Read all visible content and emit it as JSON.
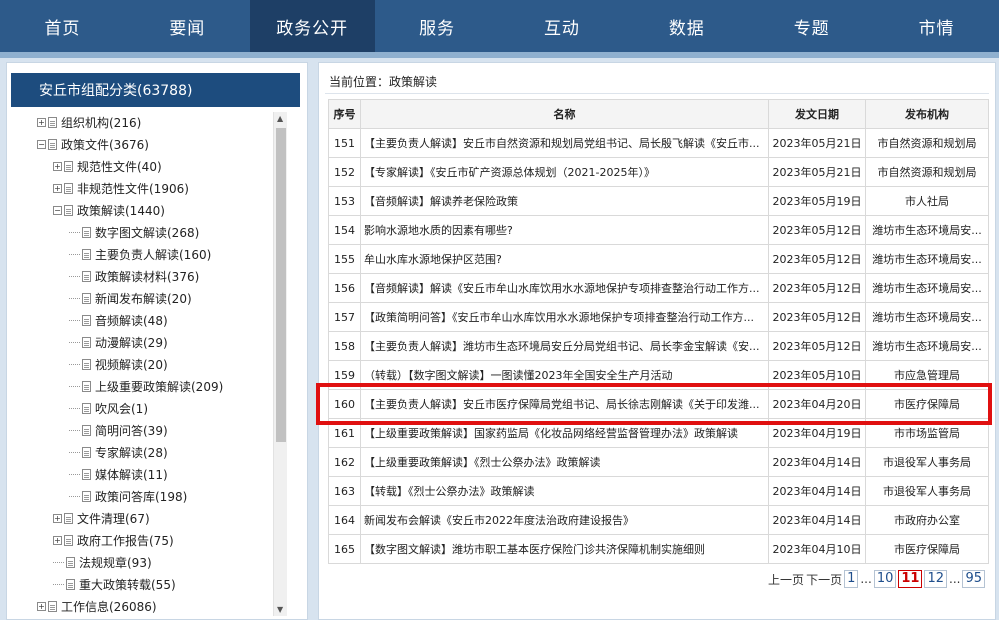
{
  "nav": {
    "items": [
      "首页",
      "要闻",
      "政务公开",
      "服务",
      "互动",
      "数据",
      "专题",
      "市情"
    ],
    "active_index": 2
  },
  "sidebar": {
    "title": "安丘市组配分类(63788)",
    "tree": [
      {
        "level": 0,
        "toggle": "+",
        "label": "组织机构(216)"
      },
      {
        "level": 0,
        "toggle": "−",
        "label": "政策文件(3676)"
      },
      {
        "level": 1,
        "toggle": "+",
        "label": "规范性文件(40)"
      },
      {
        "level": 1,
        "toggle": "+",
        "label": "非规范性文件(1906)"
      },
      {
        "level": 1,
        "toggle": "−",
        "label": "政策解读(1440)"
      },
      {
        "level": 2,
        "toggle": "",
        "label": "数字图文解读(268)"
      },
      {
        "level": 2,
        "toggle": "",
        "label": "主要负责人解读(160)"
      },
      {
        "level": 2,
        "toggle": "",
        "label": "政策解读材料(376)"
      },
      {
        "level": 2,
        "toggle": "",
        "label": "新闻发布解读(20)"
      },
      {
        "level": 2,
        "toggle": "",
        "label": "音频解读(48)"
      },
      {
        "level": 2,
        "toggle": "",
        "label": "动漫解读(29)"
      },
      {
        "level": 2,
        "toggle": "",
        "label": "视频解读(20)"
      },
      {
        "level": 2,
        "toggle": "",
        "label": "上级重要政策解读(209)"
      },
      {
        "level": 2,
        "toggle": "",
        "label": "吹风会(1)"
      },
      {
        "level": 2,
        "toggle": "",
        "label": "简明问答(39)"
      },
      {
        "level": 2,
        "toggle": "",
        "label": "专家解读(28)"
      },
      {
        "level": 2,
        "toggle": "",
        "label": "媒体解读(11)"
      },
      {
        "level": 2,
        "toggle": "",
        "label": "政策问答库(198)"
      },
      {
        "level": 1,
        "toggle": "+",
        "label": "文件清理(67)"
      },
      {
        "level": 1,
        "toggle": "+",
        "label": "政府工作报告(75)"
      },
      {
        "level": 1,
        "toggle": "",
        "label": "法规规章(93)"
      },
      {
        "level": 1,
        "toggle": "",
        "label": "重大政策转载(55)"
      },
      {
        "level": 0,
        "toggle": "+",
        "label": "工作信息(26086)"
      }
    ]
  },
  "main": {
    "breadcrumb": "当前位置：政策解读",
    "columns": [
      "序号",
      "名称",
      "发文日期",
      "发布机构"
    ],
    "rows": [
      {
        "no": "151",
        "title": "【主要负责人解读】安丘市自然资源和规划局党组书记、局长殷飞解读《安丘市...",
        "date": "2023年05月21日",
        "org": "市自然资源和规划局"
      },
      {
        "no": "152",
        "title": "【专家解读】《安丘市矿产资源总体规划（2021-2025年）》",
        "date": "2023年05月21日",
        "org": "市自然资源和规划局"
      },
      {
        "no": "153",
        "title": "【音频解读】解读养老保险政策",
        "date": "2023年05月19日",
        "org": "市人社局"
      },
      {
        "no": "154",
        "title": "影响水源地水质的因素有哪些?",
        "date": "2023年05月12日",
        "org": "潍坊市生态环境局安..."
      },
      {
        "no": "155",
        "title": "牟山水库水源地保护区范围?",
        "date": "2023年05月12日",
        "org": "潍坊市生态环境局安..."
      },
      {
        "no": "156",
        "title": "【音频解读】解读《安丘市牟山水库饮用水水源地保护专项排查整治行动工作方...",
        "date": "2023年05月12日",
        "org": "潍坊市生态环境局安..."
      },
      {
        "no": "157",
        "title": "【政策简明问答】《安丘市牟山水库饮用水水源地保护专项排查整治行动工作方...",
        "date": "2023年05月12日",
        "org": "潍坊市生态环境局安..."
      },
      {
        "no": "158",
        "title": "【主要负责人解读】潍坊市生态环境局安丘分局党组书记、局长李金宝解读《安...",
        "date": "2023年05月12日",
        "org": "潍坊市生态环境局安..."
      },
      {
        "no": "159",
        "title": "（转载）【数字图文解读】一图读懂2023年全国安全生产月活动",
        "date": "2023年05月10日",
        "org": "市应急管理局"
      },
      {
        "no": "160",
        "title": "【主要负责人解读】安丘市医疗保障局党组书记、局长徐志刚解读《关于印发潍...",
        "date": "2023年04月20日",
        "org": "市医疗保障局"
      },
      {
        "no": "161",
        "title": "【上级重要政策解读】国家药监局《化妆品网络经营监督管理办法》政策解读",
        "date": "2023年04月19日",
        "org": "市市场监管局"
      },
      {
        "no": "162",
        "title": "【上级重要政策解读】《烈士公祭办法》政策解读",
        "date": "2023年04月14日",
        "org": "市退役军人事务局"
      },
      {
        "no": "163",
        "title": "【转载】《烈士公祭办法》政策解读",
        "date": "2023年04月14日",
        "org": "市退役军人事务局"
      },
      {
        "no": "164",
        "title": "新闻发布会解读《安丘市2022年度法治政府建设报告》",
        "date": "2023年04月14日",
        "org": "市政府办公室"
      },
      {
        "no": "165",
        "title": "【数字图文解读】潍坊市职工基本医疗保险门诊共济保障机制实施细则",
        "date": "2023年04月10日",
        "org": "市医疗保障局"
      }
    ],
    "highlighted_row": "160",
    "pager": {
      "prev": "上一页",
      "next": "下一页",
      "pages": [
        "1",
        "...",
        "10",
        "11",
        "12",
        "...",
        "95"
      ],
      "current": "11"
    }
  },
  "colors": {
    "nav_bg": "#2d5a8a",
    "nav_active": "#1e3f66",
    "sidebar_title_bg": "#1d4c7e",
    "highlight": "#e01010"
  }
}
